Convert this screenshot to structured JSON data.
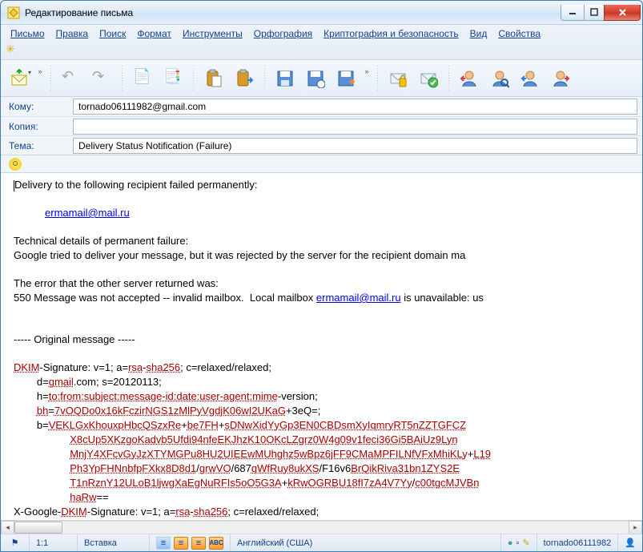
{
  "window": {
    "title": "Редактирование письма"
  },
  "menu": {
    "items": [
      "Письмо",
      "Правка",
      "Поиск",
      "Формат",
      "Инструменты",
      "Орфография",
      "Криптография и безопасность",
      "Вид",
      "Свойства"
    ]
  },
  "fields": {
    "to_label": "Кому:",
    "to_value": "tornado06111982@gmail.com",
    "cc_label": "Копия:",
    "cc_value": "",
    "subj_label": "Тема:",
    "subj_value": "Delivery Status Notification (Failure)"
  },
  "body": {
    "l1": "Delivery to the following recipient failed permanently:",
    "addr1": "ermamail@mail.ru",
    "l3": "Technical details of permanent failure:",
    "l4": "Google tried to deliver your message, but it was rejected by the server for the recipient domain ma",
    "l5": "The error that the other server returned was:",
    "l6a": "550 Message was not accepted -- invalid mailbox.  Local mailbox ",
    "addr2": "ermamail@mail.ru",
    "l6b": " is unavailable: us",
    "l7": "----- Original message -----",
    "l8a": "DKIM",
    "l8b": "-Signature: v=1; a=",
    "l8c": "rsa",
    "l8d": "-",
    "l8e": "sha256",
    "l8f": "; c=relaxed/relaxed;",
    "l9a": "        d=",
    "l9b": "gmail",
    "l9c": ".com; s=20120113;",
    "l10a": "        h=",
    "l10b": "to:from:subject:message-id:date:user-agent:mime",
    "l10c": "-version;",
    "l11a": "        ",
    "l11b": "bh",
    "l11c": "=",
    "l11d": "7vOQDo0x16kFczirNGS1zMlPyVgdjK06wI2UKaG",
    "l11e": "+3eQ=;",
    "l12a": "        b=",
    "l12b": "VEKLGxKhouxpHbcQSzxRe",
    "l12c": "+",
    "l12d": "be7FH",
    "l12e": "+",
    "l12f": "sDNwXidYyGp3EN0CBDsmXyIqmryRT5nZZTGFCZ",
    "l13": "X8cUp5XKzgoKadvb5Ufdi94nfeEKJhzK10OKcLZgrz0W4g09v1feci36Gi5BAiUz9Lyn",
    "l14a": "MnjY4XFcvGyJzXTYMGPu8HU2UIEEwMUhghz5wBpz6jFF9CMaMPFILNfVFxMhiKLy",
    "l14b": "+",
    "l14c": "L19",
    "l15a": "Ph3YpFHNnbfpFXkx8D8d1",
    "l15b": "/",
    "l15c": "grwVO",
    "l15d": "/687",
    "l15e": "qWfRuy8ukXS",
    "l15f": "/F16v6",
    "l15g": "BrQikRiva31bn1ZYS2E",
    "l16a": "T1nRznY12ULoB1ljwgXaEgNuRFIs5oO5G3A",
    "l16b": "+",
    "l16c": "kRwOGRBU18fI7zA4V7Yy",
    "l16d": "/",
    "l16e": "c00tgcMJVBn",
    "l17a": "haRw",
    "l17b": "==",
    "l18a": "X-Google-",
    "l18b": "DKIM",
    "l18c": "-Signature: v=1; a=",
    "l18d": "rsa",
    "l18e": "-",
    "l18f": "sha256",
    "l18g": "; c=relaxed/relaxed;"
  },
  "status": {
    "pos": "1:1",
    "mode": "Вставка",
    "lang": "Английский (США)",
    "account": "tornado06111982"
  }
}
